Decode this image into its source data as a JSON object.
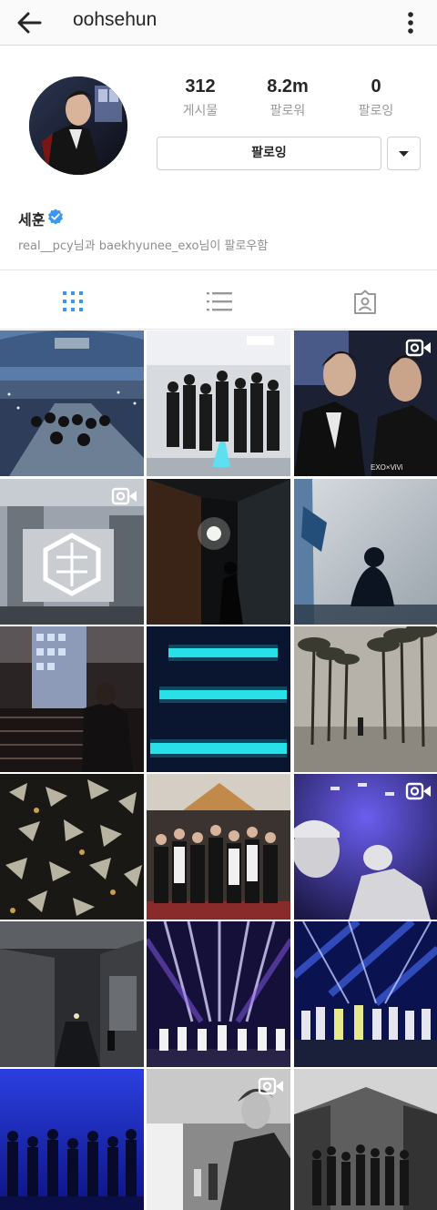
{
  "header": {
    "username": "oohsehun",
    "back_icon": "back-arrow-icon",
    "more_icon": "more-vertical-icon"
  },
  "profile": {
    "stats": [
      {
        "value": "312",
        "label": "게시물"
      },
      {
        "value": "8.2m",
        "label": "팔로워"
      },
      {
        "value": "0",
        "label": "팔로잉"
      }
    ],
    "follow_button": "팔로잉",
    "full_name": "세훈",
    "verified": true,
    "followed_by": "real__pcy님과 baekhyunee_exo님이 팔로우함"
  },
  "tabs": [
    {
      "icon": "grid-icon",
      "active": true
    },
    {
      "icon": "list-icon",
      "active": false
    },
    {
      "icon": "tagged-icon",
      "active": false
    }
  ],
  "posts": [
    {
      "name": "post-concert-stage",
      "video": false
    },
    {
      "name": "post-group-backstage",
      "video": false
    },
    {
      "name": "post-magazine-portrait",
      "video": true
    },
    {
      "name": "post-shibuya-billboard",
      "video": true
    },
    {
      "name": "post-dark-alley",
      "video": false
    },
    {
      "name": "post-shadow-silhouette",
      "video": false
    },
    {
      "name": "post-night-building",
      "video": false
    },
    {
      "name": "post-neon-lines",
      "video": false
    },
    {
      "name": "post-palm-trees",
      "video": false
    },
    {
      "name": "post-paper-installation",
      "video": false
    },
    {
      "name": "post-awards-group",
      "video": false
    },
    {
      "name": "post-selfie-video",
      "video": true
    },
    {
      "name": "post-night-street",
      "video": false
    },
    {
      "name": "post-stage-purple-lights",
      "video": false
    },
    {
      "name": "post-stage-blue-lights",
      "video": false
    },
    {
      "name": "post-blue-stage-dancers",
      "video": false
    },
    {
      "name": "post-bw-candid",
      "video": true
    },
    {
      "name": "post-bw-street-group",
      "video": false
    }
  ],
  "colors": {
    "accent_blue": "#3897f0",
    "text": "#262626",
    "muted": "#999999"
  }
}
